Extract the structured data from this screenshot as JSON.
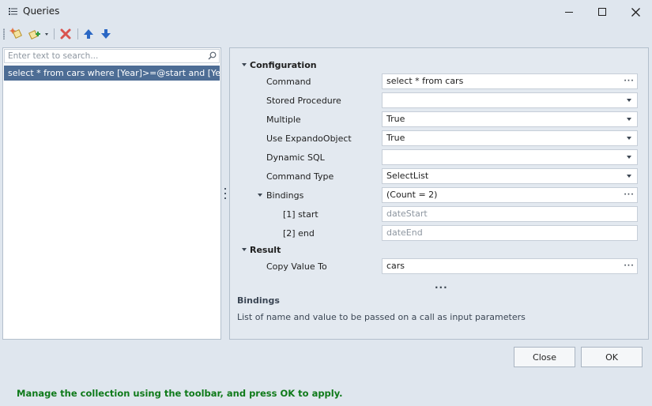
{
  "window": {
    "title": "Queries"
  },
  "toolbar": {
    "buttons": [
      "add-query-icon",
      "add-from-template-icon",
      "delete-icon",
      "move-up-icon",
      "move-down-icon"
    ],
    "colors": {
      "delete": "#d9534f",
      "arrows": "#2a67c4"
    }
  },
  "search": {
    "placeholder": "Enter text to search...",
    "value": ""
  },
  "list": {
    "items": [
      {
        "text": "select * from cars where [Year]>=@start and [Year"
      }
    ]
  },
  "properties": {
    "configuration": {
      "header": "Configuration",
      "command": {
        "label": "Command",
        "value": "select * from cars"
      },
      "stored_procedure": {
        "label": "Stored Procedure",
        "value": ""
      },
      "multiple": {
        "label": "Multiple",
        "value": "True"
      },
      "use_expando": {
        "label": "Use ExpandoObject",
        "value": "True"
      },
      "dynamic_sql": {
        "label": "Dynamic SQL",
        "value": ""
      },
      "command_type": {
        "label": "Command Type",
        "value": "SelectList"
      },
      "bindings": {
        "label": "Bindings",
        "value": "(Count = 2)",
        "items": [
          {
            "label": "[1] start",
            "value": "dateStart"
          },
          {
            "label": "[2] end",
            "value": "dateEnd"
          }
        ]
      }
    },
    "result": {
      "header": "Result",
      "copy_value_to": {
        "label": "Copy Value To",
        "value": "cars"
      }
    },
    "more": "..."
  },
  "description": {
    "title": "Bindings",
    "text": "List of name and value to be passed on a call as input parameters"
  },
  "buttons": {
    "close": "Close",
    "ok": "OK"
  },
  "footer": {
    "hint": "Manage the collection using the toolbar, and press OK to apply.",
    "hint_color": "#0f7a1a"
  },
  "colors": {
    "selection": "#4d6d95",
    "window_bg": "#dfe6ee"
  }
}
